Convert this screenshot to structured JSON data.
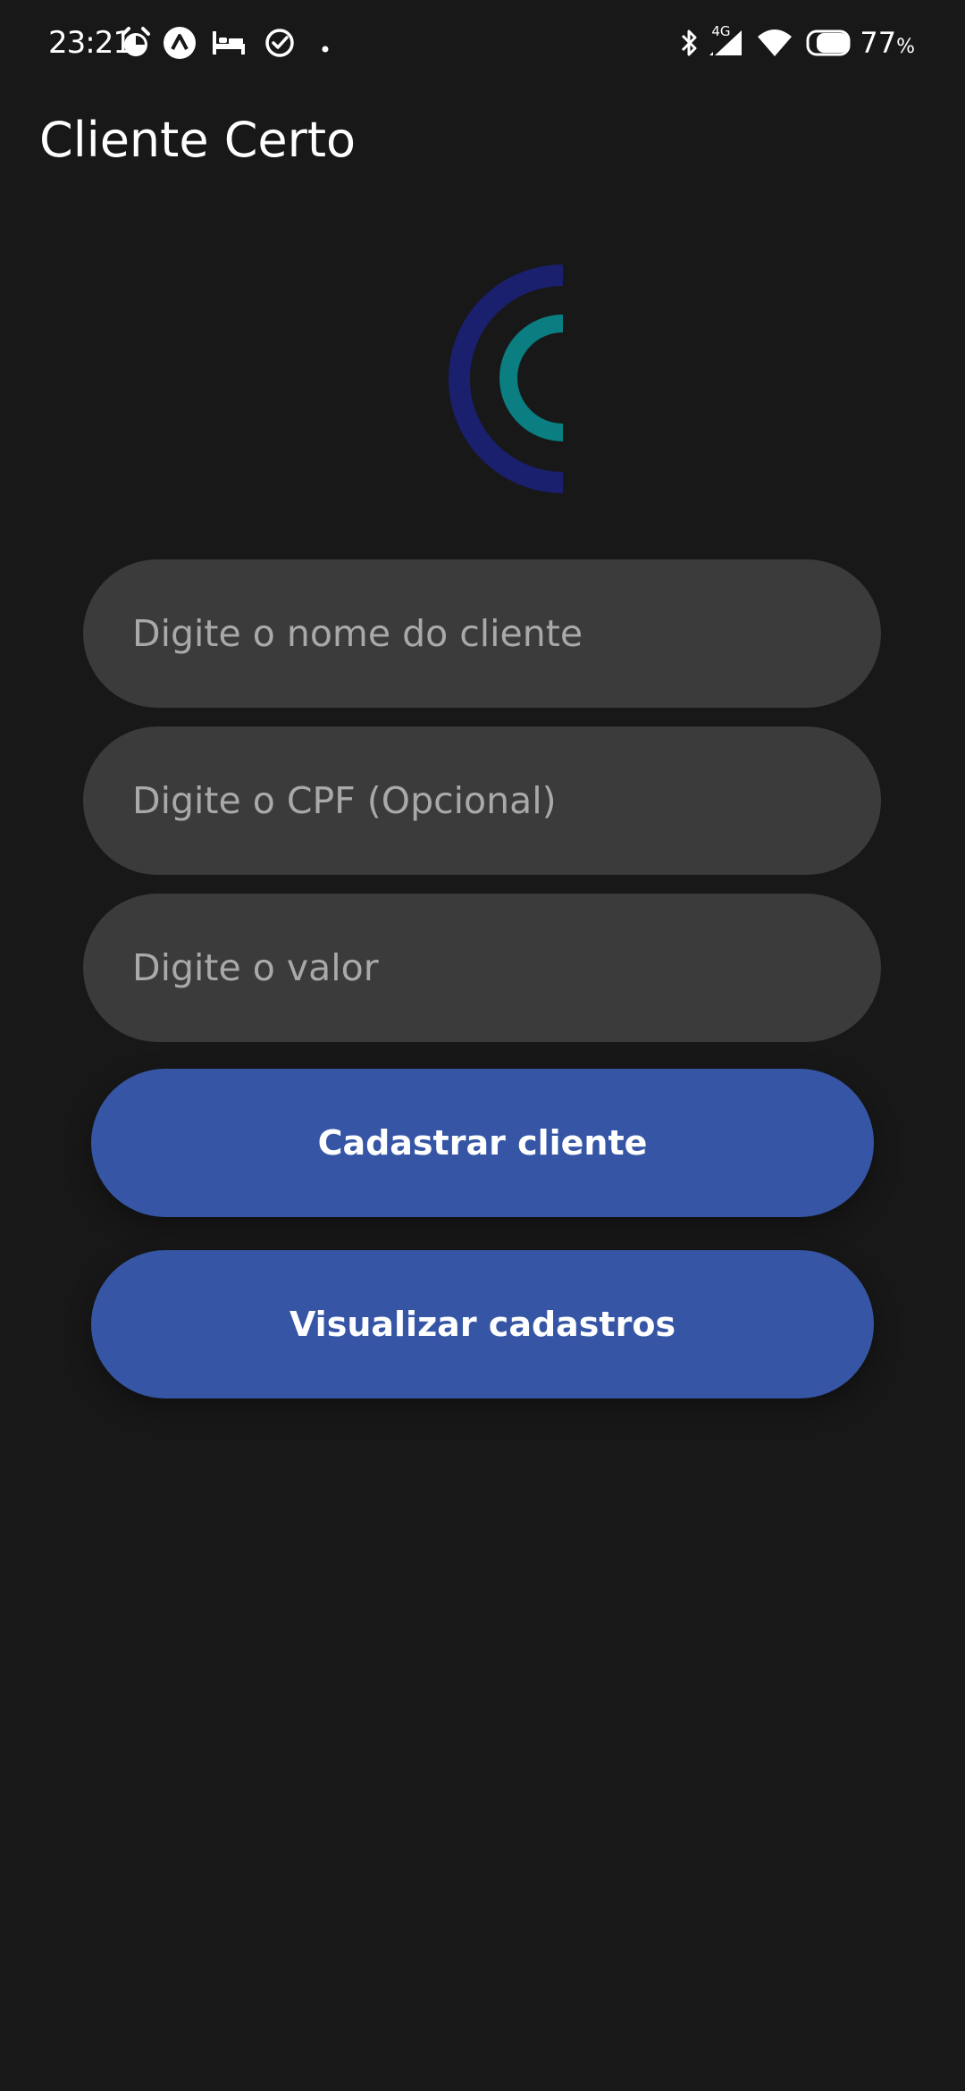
{
  "status_bar": {
    "time": "23:21",
    "notification_icons": [
      "alarm-icon",
      "app-notification-icon",
      "bed-icon",
      "check-circle-icon",
      "dot-icon"
    ],
    "system_icons": [
      "bluetooth-icon",
      "signal-icon",
      "wifi-icon",
      "battery-icon"
    ],
    "network_type": "4G",
    "battery_percent": "77",
    "battery_unit": "%"
  },
  "app_bar": {
    "title": "Cliente Certo"
  },
  "logo": {
    "outer_color": "#1a1f6e",
    "inner_color": "#0a7e80"
  },
  "form": {
    "name_placeholder": "Digite o nome do cliente",
    "cpf_placeholder": "Digite o CPF (Opcional)",
    "value_placeholder": "Digite o valor",
    "register_button_label": "Cadastrar cliente",
    "view_button_label": "Visualizar cadastros"
  },
  "colors": {
    "background": "#181818",
    "input_background": "#3b3b3b",
    "placeholder": "#a9a9a9",
    "button": "#3656a5"
  }
}
